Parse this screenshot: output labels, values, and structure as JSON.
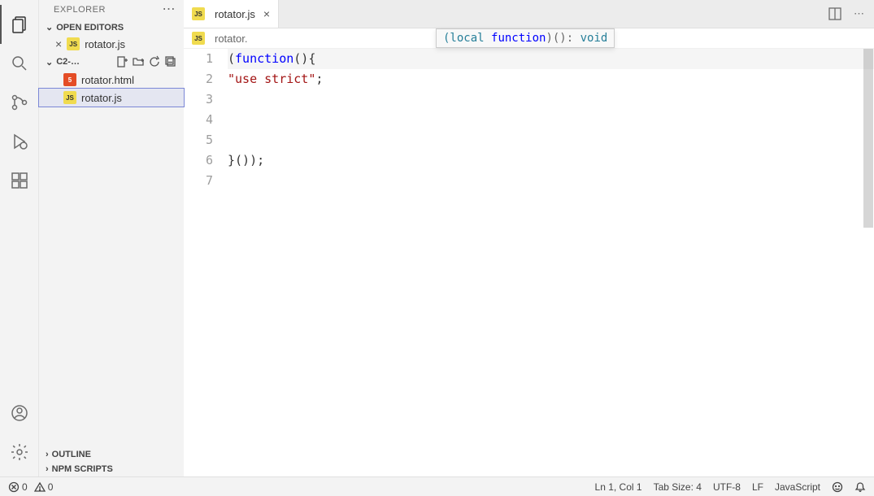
{
  "sidebar": {
    "title": "EXPLORER",
    "sections": {
      "open_editors": "OPEN EDITORS",
      "folder": "C2-…",
      "outline": "OUTLINE",
      "npm_scripts": "NPM SCRIPTS"
    },
    "open_editors_items": [
      {
        "name": "rotator.js",
        "icon": "js"
      }
    ],
    "files": [
      {
        "name": "rotator.html",
        "icon": "html",
        "selected": false
      },
      {
        "name": "rotator.js",
        "icon": "js",
        "selected": true
      }
    ]
  },
  "tabs": [
    {
      "name": "rotator.js",
      "icon": "js"
    }
  ],
  "breadcrumb": {
    "file": "rotator."
  },
  "tooltip": {
    "local": "(local ",
    "function": "function",
    "after": ")(): ",
    "void": "void"
  },
  "editor": {
    "lines": [
      {
        "n": "1",
        "tokens": [
          {
            "t": "(",
            "c": "punct"
          },
          {
            "t": "function",
            "c": "keyword"
          },
          {
            "t": "(){",
            "c": "punct"
          }
        ]
      },
      {
        "n": "2",
        "tokens": [
          {
            "t": "    ",
            "c": "punct"
          },
          {
            "t": "\"use strict\"",
            "c": "string"
          },
          {
            "t": ";",
            "c": "punct"
          }
        ]
      },
      {
        "n": "3",
        "tokens": []
      },
      {
        "n": "4",
        "tokens": []
      },
      {
        "n": "5",
        "tokens": []
      },
      {
        "n": "6",
        "tokens": [
          {
            "t": "}());",
            "c": "punct"
          }
        ]
      },
      {
        "n": "7",
        "tokens": []
      }
    ]
  },
  "status": {
    "errors": "0",
    "warnings": "0",
    "lncol": "Ln 1, Col 1",
    "tabsize": "Tab Size: 4",
    "encoding": "UTF-8",
    "eol": "LF",
    "language": "JavaScript"
  }
}
